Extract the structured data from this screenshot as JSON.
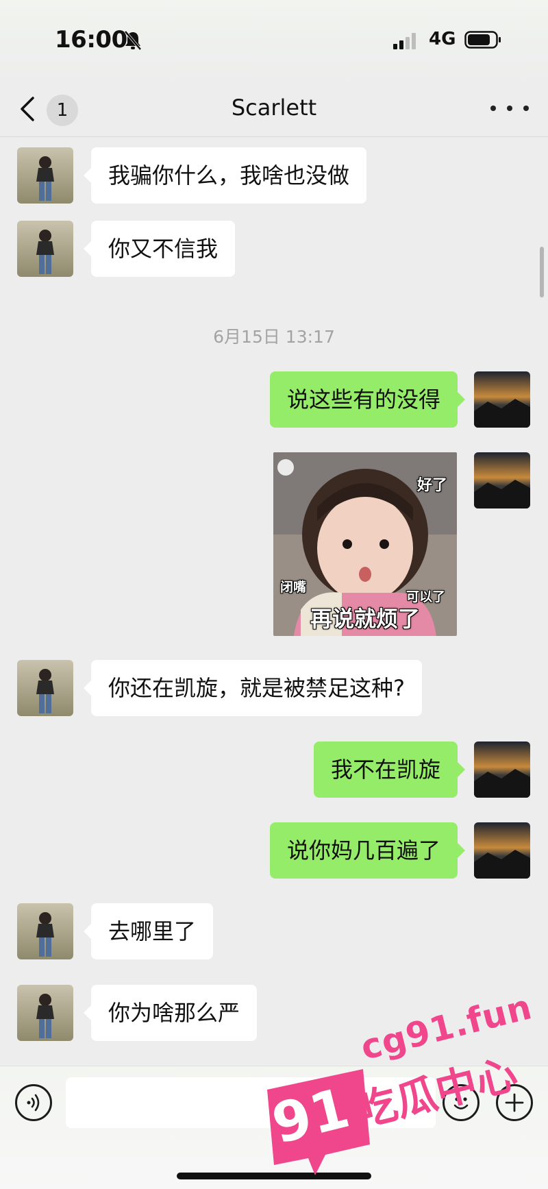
{
  "status_bar": {
    "time": "16:00",
    "network": "4G",
    "icons": [
      "bell-muted-icon",
      "signal-icon",
      "battery-icon"
    ]
  },
  "nav": {
    "back_icon": "chevron-left-icon",
    "unread_count": "1",
    "title": "Scarlett",
    "more_icon": "more-dots-icon"
  },
  "messages": [
    {
      "side": "in",
      "text": "我骗你什么，我啥也没做"
    },
    {
      "side": "in",
      "text": "你又不信我"
    },
    {
      "type": "timestamp",
      "text": "6月15日 13:17"
    },
    {
      "side": "out",
      "text": "说这些有的没得"
    },
    {
      "side": "out",
      "type": "sticker",
      "captions": {
        "main": "再说就烦了",
        "top": "好了",
        "left": "闭嘴",
        "right": "可以了"
      }
    },
    {
      "side": "in",
      "text": "你还在凯旋，就是被禁足这种?"
    },
    {
      "side": "out",
      "text": "我不在凯旋"
    },
    {
      "side": "out",
      "text": "说你妈几百遍了"
    },
    {
      "side": "in",
      "text": "去哪里了"
    },
    {
      "side": "in",
      "text": "你为啥那么严"
    }
  ],
  "input_bar": {
    "voice_icon": "voice-icon",
    "emoji_icon": "emoji-icon",
    "plus_icon": "plus-icon",
    "input_value": ""
  },
  "watermark": {
    "site": "cg91.fun",
    "name": "吃瓜中心",
    "badge": "91"
  },
  "colors": {
    "background": "#ededed",
    "outgoing_bubble": "#95ec69",
    "incoming_bubble": "#ffffff",
    "watermark": "#f0468c"
  }
}
